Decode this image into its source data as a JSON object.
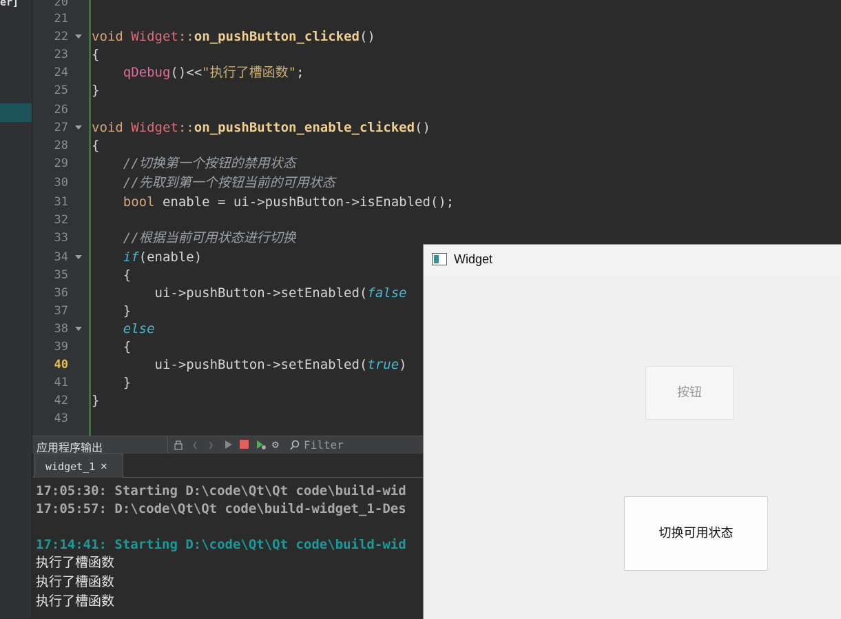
{
  "left_panel": {
    "fragment": "er]"
  },
  "editor": {
    "current_line": 40,
    "lines": [
      {
        "n": "20"
      },
      {
        "n": "21"
      },
      {
        "n": "22"
      },
      {
        "n": "23"
      },
      {
        "n": "24"
      },
      {
        "n": "25"
      },
      {
        "n": "26"
      },
      {
        "n": "27"
      },
      {
        "n": "28"
      },
      {
        "n": "29"
      },
      {
        "n": "30"
      },
      {
        "n": "31"
      },
      {
        "n": "32"
      },
      {
        "n": "33"
      },
      {
        "n": "34"
      },
      {
        "n": "35"
      },
      {
        "n": "36"
      },
      {
        "n": "37"
      },
      {
        "n": "38"
      },
      {
        "n": "39"
      },
      {
        "n": "40"
      },
      {
        "n": "41"
      },
      {
        "n": "42"
      },
      {
        "n": "43"
      }
    ],
    "code": {
      "l22_void": "void",
      "l22_cls": "Widget",
      "l22_sep": "::",
      "l22_fn": "on_pushButton_clicked",
      "l22_end": "()",
      "l23": "{",
      "l24_fn": "qDebug",
      "l24_mid": "()<<",
      "l24_str": "\"执行了槽函数\"",
      "l24_end": ";",
      "l25": "}",
      "l27_void": "void",
      "l27_cls": "Widget",
      "l27_sep": "::",
      "l27_fn": "on_pushButton_enable_clicked",
      "l27_end": "()",
      "l28": "{",
      "l29": "//切换第一个按钮的禁用状态",
      "l30": "//先取到第一个按钮当前的可用状态",
      "l31_kw": "bool",
      "l31_rest": " enable = ui->pushButton->isEnabled();",
      "l33": "//根据当前可用状态进行切换",
      "l34_kw": "if",
      "l34_rest": "(enable)",
      "l35": "{",
      "l36_pre": "ui->pushButton->setEnabled(",
      "l36_it": "false",
      "l37": "}",
      "l38": "else",
      "l39": "{",
      "l40_pre": "ui->pushButton->setEnabled(",
      "l40_it": "true",
      "l40_end": ")",
      "l41": "}",
      "l42": "}"
    }
  },
  "output": {
    "title": "应用程序输出",
    "filter_label": "Filter",
    "tab_label": "widget_1",
    "close_glyph": "✕",
    "lines": [
      "17:05:30: Starting D:\\code\\Qt\\Qt code\\build-wid",
      "17:05:57: D:\\code\\Qt\\Qt code\\build-widget_1-Des",
      "17:14:41: Starting D:\\code\\Qt\\Qt code\\build-wid",
      "执行了槽函数",
      "执行了槽函数",
      "执行了槽函数"
    ]
  },
  "widget_window": {
    "title": "Widget",
    "button_disabled_label": "按钮",
    "button_toggle_label": "切换可用状态"
  },
  "colors": {
    "accent_teal": "#1a9a9a",
    "green_bar": "#2e7d32",
    "current_line_number": "#e6c04c"
  }
}
